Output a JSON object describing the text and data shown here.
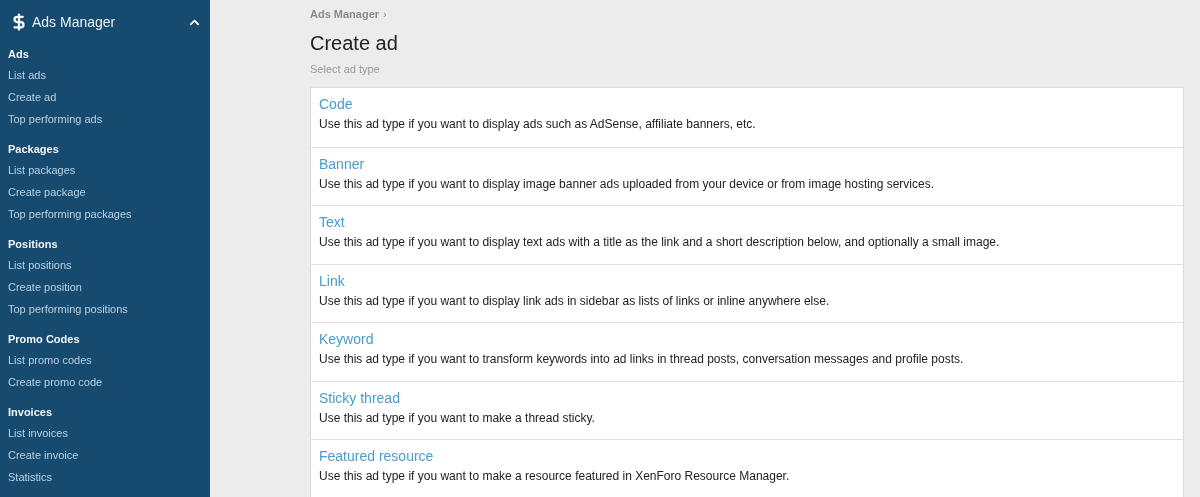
{
  "sidebar": {
    "title": "Ads Manager",
    "expanded": true,
    "groups": [
      {
        "heading": "Ads",
        "items": [
          "List ads",
          "Create ad",
          "Top performing ads"
        ]
      },
      {
        "heading": "Packages",
        "items": [
          "List packages",
          "Create package",
          "Top performing packages"
        ]
      },
      {
        "heading": "Positions",
        "items": [
          "List positions",
          "Create position",
          "Top performing positions"
        ]
      },
      {
        "heading": "Promo Codes",
        "items": [
          "List promo codes",
          "Create promo code"
        ]
      },
      {
        "heading": "Invoices",
        "items": [
          "List invoices",
          "Create invoice",
          "Statistics"
        ]
      }
    ]
  },
  "breadcrumb": {
    "label": "Ads Manager",
    "separator": "›"
  },
  "page": {
    "title": "Create ad",
    "subtitle": "Select ad type"
  },
  "ad_types": [
    {
      "name": "Code",
      "description": "Use this ad type if you want to display ads such as AdSense, affiliate banners, etc."
    },
    {
      "name": "Banner",
      "description": "Use this ad type if you want to display image banner ads uploaded from your device or from image hosting services."
    },
    {
      "name": "Text",
      "description": "Use this ad type if you want to display text ads with a title as the link and a short description below, and optionally a small image."
    },
    {
      "name": "Link",
      "description": "Use this ad type if you want to display link ads in sidebar as lists of links or inline anywhere else."
    },
    {
      "name": "Keyword",
      "description": "Use this ad type if you want to transform keywords into ad links in thread posts, conversation messages and profile posts."
    },
    {
      "name": "Sticky thread",
      "description": "Use this ad type if you want to make a thread sticky."
    },
    {
      "name": "Featured resource",
      "description": "Use this ad type if you want to make a resource featured in XenForo Resource Manager."
    }
  ]
}
